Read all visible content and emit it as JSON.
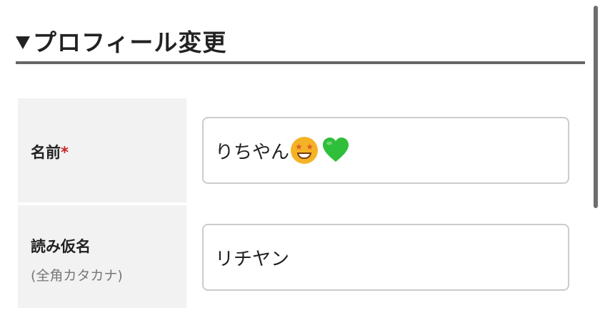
{
  "section": {
    "title": "プロフィール変更"
  },
  "form": {
    "name": {
      "label": "名前",
      "required_mark": "*",
      "value": "りちやん",
      "emojis": [
        "star-struck-emoji",
        "green-heart-emoji"
      ]
    },
    "kana": {
      "label": "読み仮名",
      "note": "(全角カタカナ)",
      "value": "リチヤン"
    }
  },
  "colors": {
    "label_background": "#f2f2f2",
    "required": "#cc2222",
    "header_rule": "#666666",
    "input_border": "#cccccc"
  }
}
